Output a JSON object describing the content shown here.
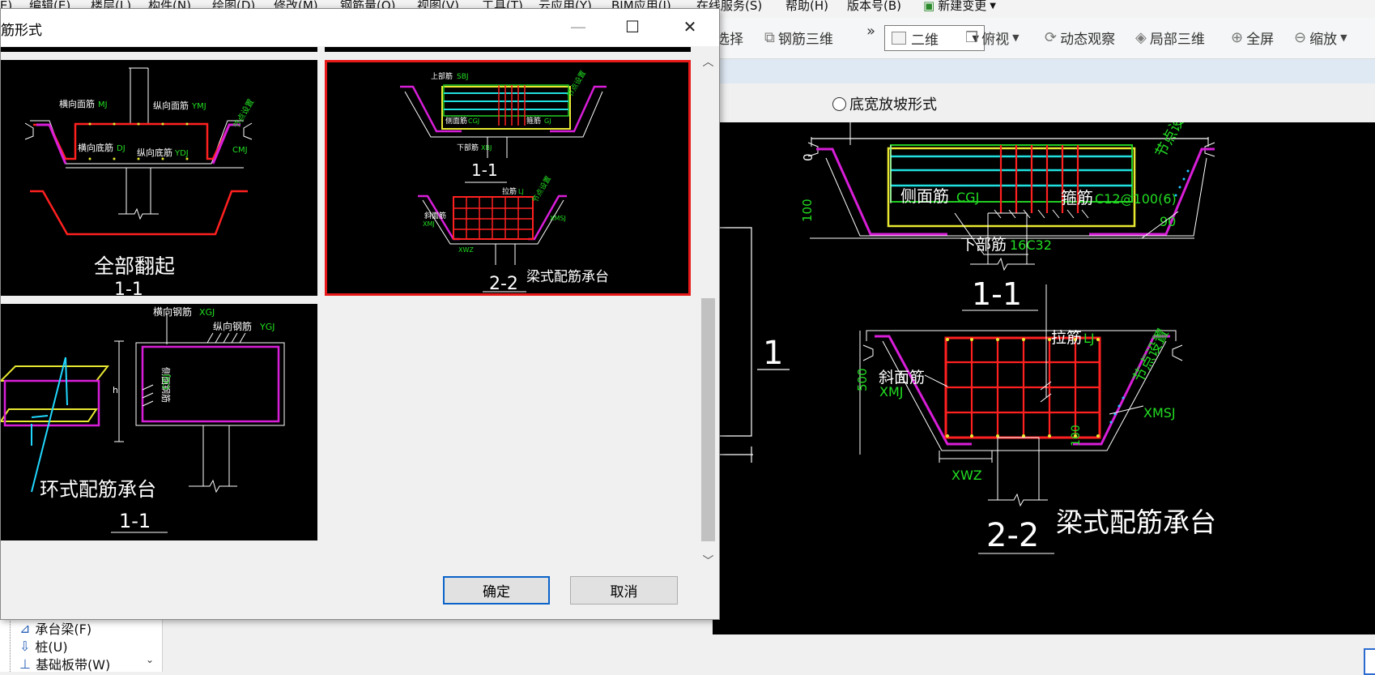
{
  "menubar": {
    "items": [
      "(E)",
      "编辑(E)",
      "楼层(L)",
      "构件(N)",
      "绘图(D)",
      "修改(M)",
      "钢筋量(Q)",
      "视图(V)",
      "工具(T)",
      "云应用(Y)",
      "BIM应用(I)",
      "在线服务(S)",
      "帮助(H)",
      "版本号(B)",
      "新建变更"
    ]
  },
  "toolbar": {
    "select_label": "选择",
    "rebar3d_label": "钢筋三维",
    "more": "»",
    "view_mode": "二维",
    "top_view": "俯视",
    "dynamic_view": "动态观察",
    "local3d": "局部三维",
    "fullscreen": "全屏",
    "zoom": "缩放"
  },
  "options": {
    "bottom_slope_label": "底宽放坡形式"
  },
  "tree": {
    "items": [
      "承台梁(F)",
      "桩(U)",
      "基础板带(W)"
    ]
  },
  "dialog": {
    "title": "筋形式",
    "ok_label": "确定",
    "cancel_label": "取消",
    "options": [
      {
        "caption": "全部翻起",
        "section": "1-1",
        "selected": false
      },
      {
        "caption": "梁式配筋承台",
        "section": "2-2",
        "section_top": "1-1",
        "selected": true
      },
      {
        "caption": "环式配筋承台",
        "section": "1-1",
        "selected": false
      }
    ]
  },
  "thumb1": {
    "labels": [
      "横向面筋",
      "MJ",
      "纵向面筋",
      "YMJ",
      "横向底筋",
      "DJ",
      "纵向底筋",
      "YDJ",
      "CMJ",
      "节点设置"
    ]
  },
  "thumb2": {
    "labels": [
      "上部筋",
      "SBJ",
      "侧面筋",
      "CGJ",
      "箍筋",
      "GJ",
      "下部筋",
      "XBJ",
      "拉筋",
      "LJ",
      "斜面筋",
      "XMJ",
      "XMSJ",
      "XWZ",
      "节点设置"
    ]
  },
  "thumb3": {
    "labels": [
      "横向钢筋",
      "XGJ",
      "纵向钢筋",
      "YGJ",
      "侧面钢筋",
      "CGJ",
      "h"
    ]
  },
  "preview": {
    "section1": "1-1",
    "section2": "2-2",
    "title": "梁式配筋承台",
    "side_label": "侧面筋",
    "side_code": "CGJ",
    "stirrup_label": "箍筋",
    "stirrup_value": "C12@100(6)",
    "bottom_label": "下部筋",
    "bottom_value": "16C32",
    "tie_label": "拉筋",
    "tie_code": "LJ",
    "slope_label": "斜面筋",
    "slope_code": "XMJ",
    "xmsj": "XMSJ",
    "xwz": "XWZ",
    "node_label": "节点设置",
    "dim_0": "0",
    "dim_100": "100",
    "dim_500": "500",
    "angle": "90",
    "axis_1": "1"
  }
}
